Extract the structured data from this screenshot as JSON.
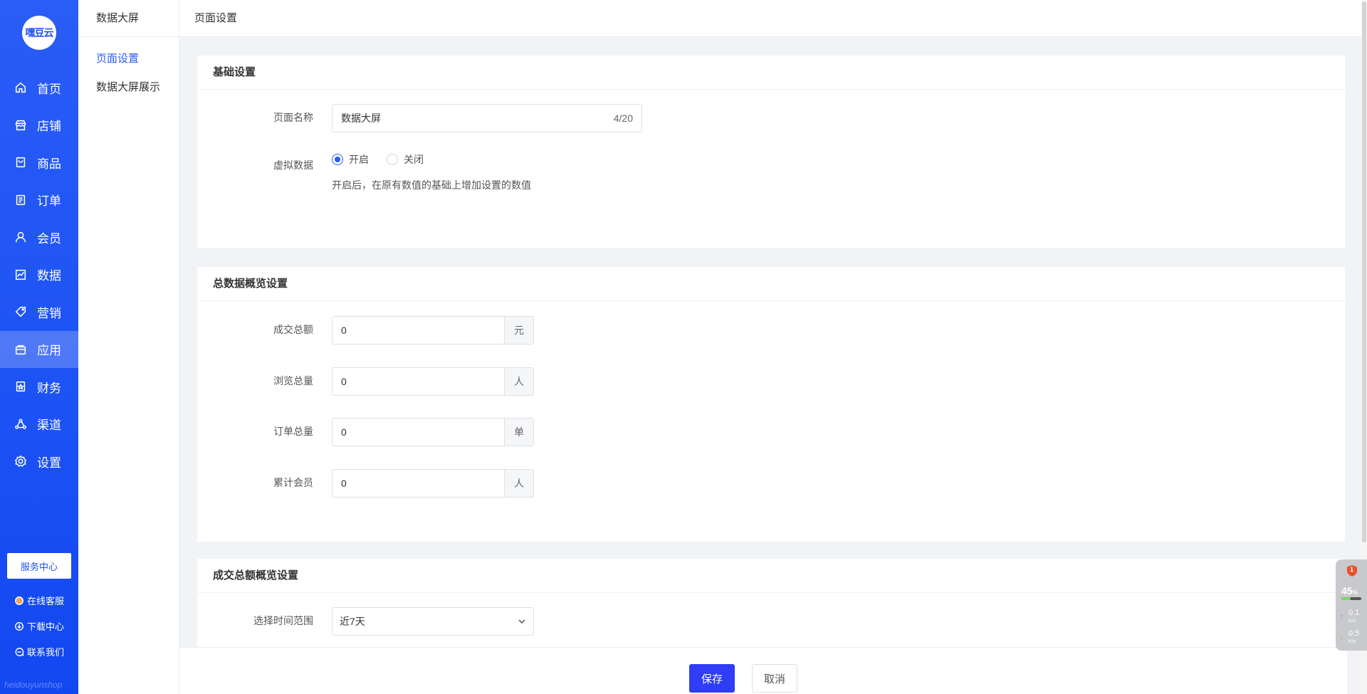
{
  "sidebar": {
    "logo_text": "嘿豆云",
    "items": [
      {
        "label": "首页",
        "icon": "home-icon"
      },
      {
        "label": "店铺",
        "icon": "store-icon"
      },
      {
        "label": "商品",
        "icon": "goods-icon"
      },
      {
        "label": "订单",
        "icon": "order-icon"
      },
      {
        "label": "会员",
        "icon": "member-icon"
      },
      {
        "label": "数据",
        "icon": "chart-icon"
      },
      {
        "label": "营销",
        "icon": "tag-icon"
      },
      {
        "label": "应用",
        "icon": "app-icon",
        "active": true
      },
      {
        "label": "财务",
        "icon": "finance-icon"
      },
      {
        "label": "渠道",
        "icon": "channel-icon"
      },
      {
        "label": "设置",
        "icon": "gear-icon"
      }
    ],
    "service_center": "服务中心",
    "online_service": "在线客服",
    "download_center": "下载中心",
    "contact_us": "联系我们",
    "brand": "heidouyunshop"
  },
  "subside": {
    "title": "数据大屏",
    "items": [
      {
        "label": "页面设置",
        "active": true
      },
      {
        "label": "数据大屏展示",
        "active": false
      }
    ]
  },
  "topbar": {
    "title": "页面设置"
  },
  "basic": {
    "title": "基础设置",
    "page_name_label": "页面名称",
    "page_name_value": "数据大屏",
    "page_name_counter": "4/20",
    "virtual_label": "虚拟数据",
    "virtual_on": "开启",
    "virtual_off": "关闭",
    "virtual_selected": "on",
    "virtual_hint": "开启后，在原有数值的基础上增加设置的数值"
  },
  "overview": {
    "title": "总数据概览设置",
    "rows": [
      {
        "label": "成交总额",
        "value": "0",
        "unit": "元"
      },
      {
        "label": "浏览总量",
        "value": "0",
        "unit": "人"
      },
      {
        "label": "订单总量",
        "value": "0",
        "unit": "单"
      },
      {
        "label": "累计会员",
        "value": "0",
        "unit": "人"
      }
    ]
  },
  "amount": {
    "title": "成交总额概览设置",
    "range_label": "选择时间范围",
    "range_value": "近7天"
  },
  "actions": {
    "save": "保存",
    "cancel": "取消"
  },
  "widget": {
    "alert_count": "1",
    "cpu_percent": "45",
    "percent_sign": "%",
    "up_speed": "0.1",
    "down_speed": "0.5",
    "speed_unit": "K/s"
  }
}
